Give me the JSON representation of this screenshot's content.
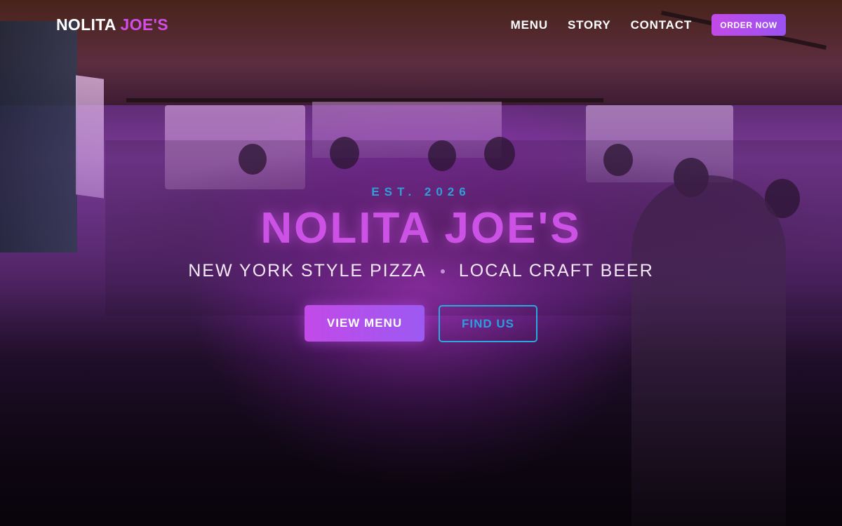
{
  "colors": {
    "brand_white": "#ffffff",
    "brand_accent": "#d24ce6",
    "cyan_accent": "#2ab4e8",
    "button_gradient_start": "#c24ae8",
    "button_gradient_end": "#9a52f0"
  },
  "nav": {
    "brand_part1": "NOLITA",
    "brand_part2": "JOE'S",
    "links": [
      {
        "label": "MENU"
      },
      {
        "label": "STORY"
      },
      {
        "label": "CONTACT"
      }
    ],
    "order_button": "ORDER NOW"
  },
  "hero": {
    "established": "EST. 2026",
    "title": "NOLITA JOE'S",
    "tagline_left": "NEW YORK STYLE PIZZA",
    "tagline_right": "LOCAL CRAFT BEER",
    "primary_button": "VIEW MENU",
    "secondary_button": "FIND US"
  }
}
